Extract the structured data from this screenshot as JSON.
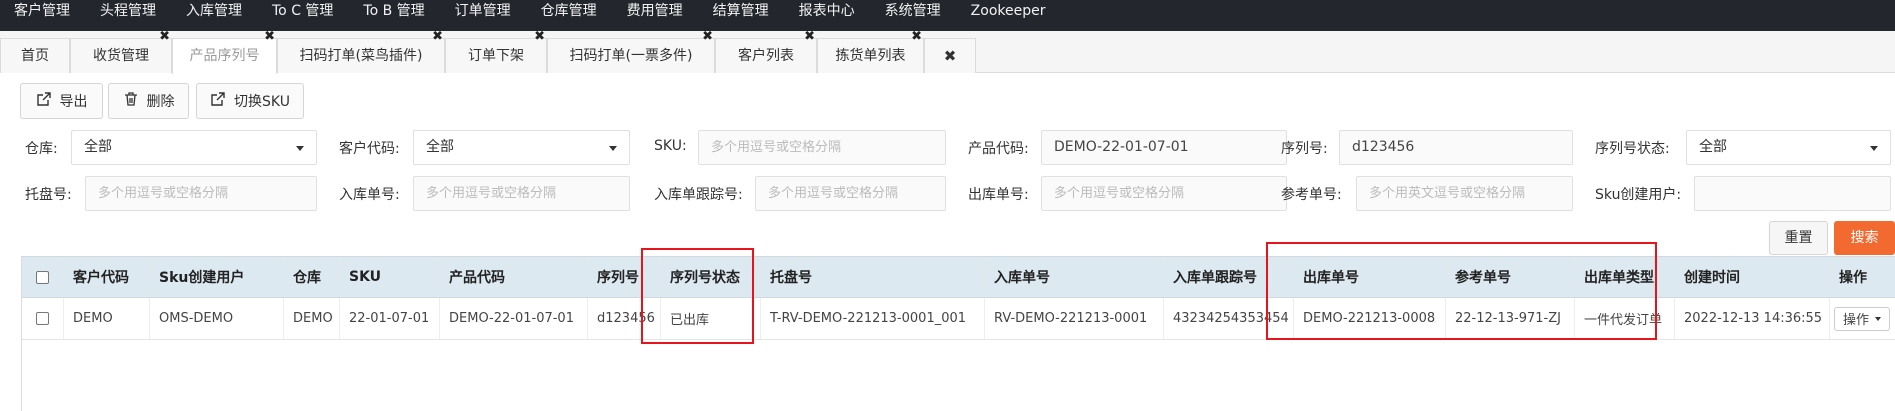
{
  "nav": [
    "客户管理",
    "头程管理",
    "入库管理",
    "To C 管理",
    "To B 管理",
    "订单管理",
    "仓库管理",
    "费用管理",
    "结算管理",
    "报表中心",
    "系统管理",
    "Zookeeper"
  ],
  "tabs": [
    {
      "label": "首页",
      "closable": false
    },
    {
      "label": "收货管理",
      "closable": true
    },
    {
      "label": "产品序列号",
      "closable": true,
      "active": true
    },
    {
      "label": "扫码打单(菜鸟插件)",
      "closable": true
    },
    {
      "label": "订单下架",
      "closable": true
    },
    {
      "label": "扫码打单(一票多件)",
      "closable": true
    },
    {
      "label": "客户列表",
      "closable": true
    },
    {
      "label": "拣货单列表",
      "closable": true
    }
  ],
  "tab_close_glyph": "✖",
  "toolbar": {
    "export": "导出",
    "delete": "删除",
    "switch_sku": "切换SKU"
  },
  "filters": {
    "warehouse": {
      "label": "仓库:",
      "value": "全部"
    },
    "customer_code": {
      "label": "客户代码:",
      "value": "全部"
    },
    "sku": {
      "label": "SKU:",
      "placeholder": "多个用逗号或空格分隔"
    },
    "product_code": {
      "label": "产品代码:",
      "value": "DEMO-22-01-07-01"
    },
    "serial_no": {
      "label": "序列号:",
      "value": "d123456"
    },
    "serial_status": {
      "label": "序列号状态:",
      "value": "全部"
    },
    "pallet_no": {
      "label": "托盘号:",
      "placeholder": "多个用逗号或空格分隔"
    },
    "inbound_no": {
      "label": "入库单号:",
      "placeholder": "多个用逗号或空格分隔"
    },
    "inbound_tracking": {
      "label": "入库单跟踪号:",
      "placeholder": "多个用逗号或空格分隔"
    },
    "outbound_no": {
      "label": "出库单号:",
      "placeholder": "多个用逗号或空格分隔"
    },
    "reference_no": {
      "label": "参考单号:",
      "placeholder": "多个用英文逗号或空格分隔"
    },
    "sku_creator": {
      "label": "Sku创建用户:",
      "value": ""
    }
  },
  "actions": {
    "reset": "重置",
    "search": "搜索"
  },
  "table": {
    "headers": [
      "客户代码",
      "Sku创建用户",
      "仓库",
      "SKU",
      "产品代码",
      "序列号",
      "序列号状态",
      "托盘号",
      "入库单号",
      "入库单跟踪号",
      "出库单号",
      "参考单号",
      "出库单类型",
      "创建时间",
      "操作"
    ],
    "rows": [
      [
        "DEMO",
        "OMS-DEMO",
        "DEMO",
        "22-01-07-01",
        "DEMO-22-01-07-01",
        "d123456",
        "已出库",
        "T-RV-DEMO-221213-0001_001",
        "RV-DEMO-221213-0001",
        "43234254353454",
        "DEMO-221213-0008",
        "22-12-13-971-ZJ",
        "一件代发订单",
        "2022-12-13 14:36:55",
        "操作"
      ]
    ]
  },
  "colors": {
    "nav_bg": "#23272d",
    "search_btn": "#f26a2f",
    "table_header": "#dde9f0",
    "highlight": "#e8141c"
  }
}
